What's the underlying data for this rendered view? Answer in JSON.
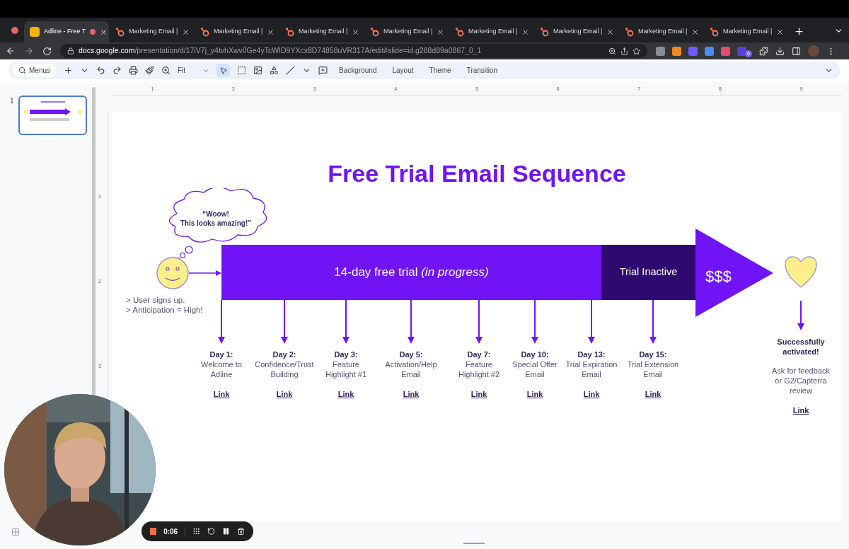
{
  "tabs": [
    {
      "title": "Adline - Free T",
      "selected": true,
      "kind": "slides"
    },
    {
      "title": "Marketing Email | ",
      "selected": false,
      "kind": "hub"
    },
    {
      "title": "Marketing Email | ",
      "selected": false,
      "kind": "hub"
    },
    {
      "title": "Marketing Email | ",
      "selected": false,
      "kind": "hub"
    },
    {
      "title": "Marketing Email | ",
      "selected": false,
      "kind": "hub"
    },
    {
      "title": "Marketing Email | ",
      "selected": false,
      "kind": "hub"
    },
    {
      "title": "Marketing Email | ",
      "selected": false,
      "kind": "hub"
    },
    {
      "title": "Marketing Email | ",
      "selected": false,
      "kind": "hub"
    },
    {
      "title": "Marketing Email | ",
      "selected": false,
      "kind": "hub"
    }
  ],
  "address": {
    "domain": "docs.google.com",
    "path": "/presentation/d/17iV7j_y4tvhXwv0Ge4yTcWID9YXcx8D74858uVR317A/edit#slide=id.g288d89a0867_0_1"
  },
  "extension_badge": "6",
  "toolbar": {
    "search": "Menus",
    "zoom": "Fit",
    "menus": [
      "Background",
      "Layout",
      "Theme",
      "Transition"
    ]
  },
  "filmstrip": [
    {
      "number": "1",
      "selected": true
    }
  ],
  "ruler": {
    "horizontal": [
      "1",
      "2",
      "3",
      "4",
      "5",
      "6",
      "7",
      "8",
      "9"
    ],
    "vertical": [
      "1",
      "2",
      "3"
    ]
  },
  "slide": {
    "title": "Free Trial Email Sequence",
    "thought": "“Woow!\nThis looks amazing!”",
    "notes": [
      "> User signs up.",
      "> Anticipation = High!"
    ],
    "bar": {
      "active": "14-day free trial *(in progress)*",
      "inactive": "Trial Inactive",
      "arrow": "$$$"
    },
    "milestones": [
      {
        "day": "Day 1:",
        "title": "Welcome to\nAdline",
        "link": "Link"
      },
      {
        "day": "Day 2:",
        "title": "Confidence/Trust\nBuilding",
        "link": "Link"
      },
      {
        "day": "Day 3:",
        "title": "Feature\nHighlight #1",
        "link": "Link"
      },
      {
        "day": "Day 5:",
        "title": "Activation/Help\nEmail",
        "link": "Link"
      },
      {
        "day": "Day 7:",
        "title": "Feature\nHighlight #2",
        "link": "Link"
      },
      {
        "day": "Day 10:",
        "title": "Special Offer\nEmail",
        "link": "Link"
      },
      {
        "day": "Day 13:",
        "title": "Trial Expiration\nEmail",
        "link": "Link"
      },
      {
        "day": "Day 15:",
        "title": "Trial Extension\nEmail",
        "link": "Link"
      }
    ],
    "outcome": {
      "heading": "Successfully\nactivated!",
      "text": "Ask for feedback\nor G2/Capterra\nreview",
      "link": "Link"
    }
  },
  "recorder": {
    "time": "0:06"
  }
}
